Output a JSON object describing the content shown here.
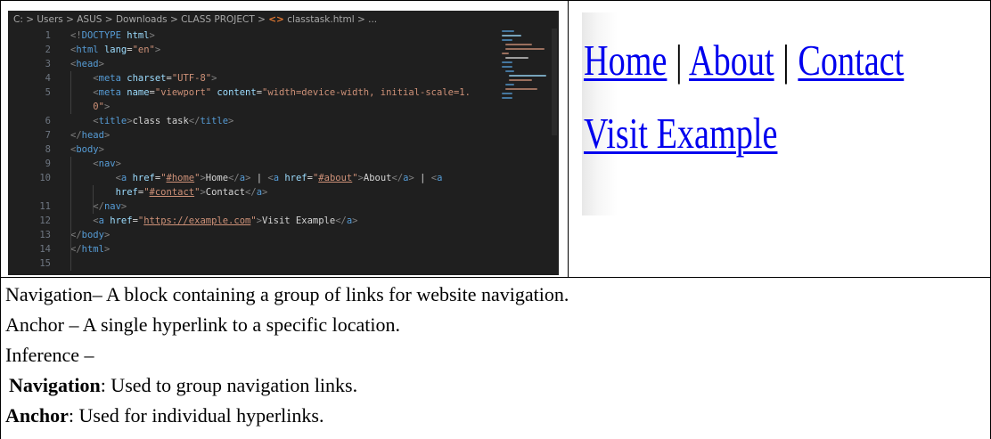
{
  "editor": {
    "breadcrumb": [
      "C:",
      "Users",
      "ASUS",
      "Downloads",
      "CLASS PROJECT",
      "classtask.html",
      "..."
    ],
    "line_numbers": [
      "1",
      "2",
      "3",
      "4",
      "5",
      "",
      "6",
      "7",
      "8",
      "9",
      "10",
      "",
      "11",
      "12",
      "13",
      "14",
      "15"
    ],
    "lines": [
      {
        "t": [
          [
            "brk",
            "<!"
          ],
          [
            "tag",
            "DOCTYPE"
          ],
          [
            "txt",
            " "
          ],
          [
            "attr",
            "html"
          ],
          [
            "brk",
            ">"
          ]
        ]
      },
      {
        "t": [
          [
            "brk",
            "<"
          ],
          [
            "tag",
            "html"
          ],
          [
            "txt",
            " "
          ],
          [
            "attr",
            "lang"
          ],
          [
            "txt",
            "="
          ],
          [
            "str",
            "\"en\""
          ],
          [
            "brk",
            ">"
          ]
        ]
      },
      {
        "t": [
          [
            "brk",
            "<"
          ],
          [
            "tag",
            "head"
          ],
          [
            "brk",
            ">"
          ]
        ]
      },
      {
        "t": [
          [
            "txt",
            "    "
          ],
          [
            "brk",
            "<"
          ],
          [
            "tag",
            "meta"
          ],
          [
            "txt",
            " "
          ],
          [
            "attr",
            "charset"
          ],
          [
            "txt",
            "="
          ],
          [
            "str",
            "\"UTF-8\""
          ],
          [
            "brk",
            ">"
          ]
        ]
      },
      {
        "t": [
          [
            "txt",
            "    "
          ],
          [
            "brk",
            "<"
          ],
          [
            "tag",
            "meta"
          ],
          [
            "txt",
            " "
          ],
          [
            "attr",
            "name"
          ],
          [
            "txt",
            "="
          ],
          [
            "str",
            "\"viewport\""
          ],
          [
            "txt",
            " "
          ],
          [
            "attr",
            "content"
          ],
          [
            "txt",
            "="
          ],
          [
            "str",
            "\"width=device-width, initial-scale=1."
          ]
        ]
      },
      {
        "t": [
          [
            "str",
            "    0\""
          ],
          [
            "brk",
            ">"
          ]
        ]
      },
      {
        "t": [
          [
            "txt",
            "    "
          ],
          [
            "brk",
            "<"
          ],
          [
            "tag",
            "title"
          ],
          [
            "brk",
            ">"
          ],
          [
            "txt",
            "class task"
          ],
          [
            "brk",
            "</"
          ],
          [
            "tag",
            "title"
          ],
          [
            "brk",
            ">"
          ]
        ]
      },
      {
        "t": [
          [
            "brk",
            "</"
          ],
          [
            "tag",
            "head"
          ],
          [
            "brk",
            ">"
          ]
        ]
      },
      {
        "t": [
          [
            "brk",
            "<"
          ],
          [
            "tag",
            "body"
          ],
          [
            "brk",
            ">"
          ]
        ]
      },
      {
        "t": [
          [
            "txt",
            "    "
          ],
          [
            "brk",
            "<"
          ],
          [
            "tag",
            "nav"
          ],
          [
            "brk",
            ">"
          ]
        ]
      },
      {
        "t": [
          [
            "txt",
            "        "
          ],
          [
            "brk",
            "<"
          ],
          [
            "tag",
            "a"
          ],
          [
            "txt",
            " "
          ],
          [
            "attr",
            "href"
          ],
          [
            "txt",
            "="
          ],
          [
            "str",
            "\""
          ],
          [
            "lnk",
            "#home"
          ],
          [
            "str",
            "\""
          ],
          [
            "brk",
            ">"
          ],
          [
            "txt",
            "Home"
          ],
          [
            "brk",
            "</"
          ],
          [
            "tag",
            "a"
          ],
          [
            "brk",
            ">"
          ],
          [
            "txt",
            " | "
          ],
          [
            "brk",
            "<"
          ],
          [
            "tag",
            "a"
          ],
          [
            "txt",
            " "
          ],
          [
            "attr",
            "href"
          ],
          [
            "txt",
            "="
          ],
          [
            "str",
            "\""
          ],
          [
            "lnk",
            "#about"
          ],
          [
            "str",
            "\""
          ],
          [
            "brk",
            ">"
          ],
          [
            "txt",
            "About"
          ],
          [
            "brk",
            "</"
          ],
          [
            "tag",
            "a"
          ],
          [
            "brk",
            ">"
          ],
          [
            "txt",
            " | "
          ],
          [
            "brk",
            "<"
          ],
          [
            "tag",
            "a"
          ]
        ]
      },
      {
        "t": [
          [
            "txt",
            "        "
          ],
          [
            "attr",
            "href"
          ],
          [
            "txt",
            "="
          ],
          [
            "str",
            "\""
          ],
          [
            "lnk",
            "#contact"
          ],
          [
            "str",
            "\""
          ],
          [
            "brk",
            ">"
          ],
          [
            "txt",
            "Contact"
          ],
          [
            "brk",
            "</"
          ],
          [
            "tag",
            "a"
          ],
          [
            "brk",
            ">"
          ]
        ]
      },
      {
        "t": [
          [
            "txt",
            "    "
          ],
          [
            "brk",
            "</"
          ],
          [
            "tag",
            "nav"
          ],
          [
            "brk",
            ">"
          ]
        ]
      },
      {
        "t": [
          [
            "txt",
            "    "
          ],
          [
            "brk",
            "<"
          ],
          [
            "tag",
            "a"
          ],
          [
            "txt",
            " "
          ],
          [
            "attr",
            "href"
          ],
          [
            "txt",
            "="
          ],
          [
            "str",
            "\""
          ],
          [
            "lnk",
            "https://example.com"
          ],
          [
            "str",
            "\""
          ],
          [
            "brk",
            ">"
          ],
          [
            "txt",
            "Visit Example"
          ],
          [
            "brk",
            "</"
          ],
          [
            "tag",
            "a"
          ],
          [
            "brk",
            ">"
          ]
        ]
      },
      {
        "t": [
          [
            "brk",
            "</"
          ],
          [
            "tag",
            "body"
          ],
          [
            "brk",
            ">"
          ]
        ]
      },
      {
        "t": [
          [
            "brk",
            "</"
          ],
          [
            "tag",
            "html"
          ],
          [
            "brk",
            ">"
          ]
        ]
      },
      {
        "t": []
      }
    ]
  },
  "render": {
    "home": "Home",
    "about": "About",
    "contact": "Contact",
    "separator": "|",
    "visit": "Visit Example",
    "link_color": "#0000ee"
  },
  "description": {
    "line1": "Navigation– A block containing a group of links for website navigation.",
    "line2": "Anchor – A single hyperlink to a specific location.",
    "line3": "Inference –",
    "line4_bold": "Navigation",
    "line4_rest": ": Used to group navigation links.",
    "line5_bold": "Anchor",
    "line5_rest": ": Used for individual hyperlinks."
  }
}
